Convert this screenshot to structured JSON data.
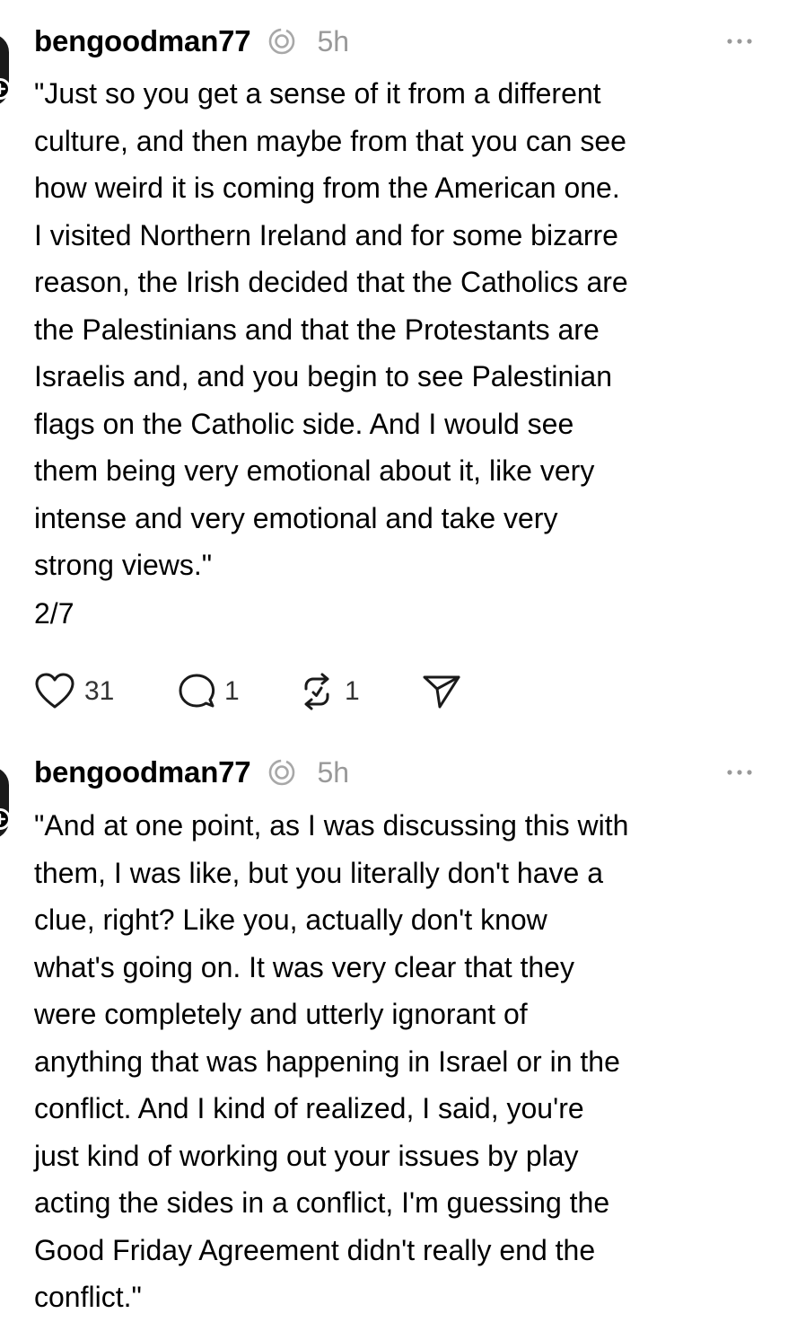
{
  "posts": [
    {
      "username": "bengoodman77",
      "time": "5h",
      "text": "\"Just so you get a sense of it from a different\nculture, and then maybe from that you can see\nhow weird it is coming from the American one.\nI visited Northern Ireland and for some bizarre\nreason, the Irish decided that the Catholics are\nthe Palestinians and that the Protestants are\nIsraelis and, and you begin to see Palestinian\nflags on the Catholic side. And I would see\nthem being very emotional about it, like very\nintense and very emotional and take very\nstrong views.\"",
      "thread_position": "2/7",
      "likes": "31",
      "replies": "1",
      "reposts": "1"
    },
    {
      "username": "bengoodman77",
      "time": "5h",
      "text": "\"And at one point, as I was discussing this with\nthem, I was like, but you literally don't have a\nclue, right? Like you, actually don't know\nwhat's going on. It was very clear that they\nwere completely and utterly ignorant of\nanything that was happening in Israel or in the\nconflict. And I kind of realized, I said, you're\njust kind of working out your issues by play\nacting the sides in a conflict, I'm guessing the\nGood Friday Agreement didn't really end the\nconflict.\""
    }
  ],
  "icons": {
    "verified": "threads-verified-icon",
    "more": "more-options-icon",
    "like": "heart-icon",
    "reply": "comment-icon",
    "repost": "repost-icon",
    "share": "send-icon"
  },
  "colors": {
    "text": "#000000",
    "muted": "#999999",
    "counts": "#333333"
  }
}
